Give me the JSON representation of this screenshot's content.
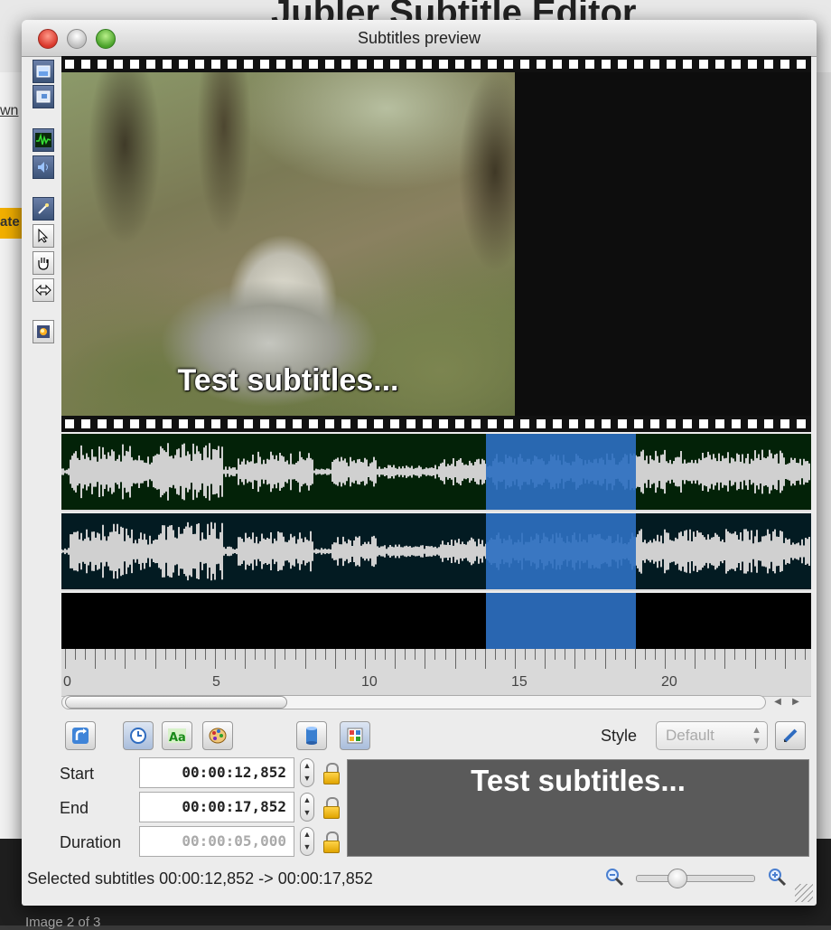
{
  "background": {
    "page_title": "Jubler Subtitle Editor",
    "fragment_1": "wn",
    "fragment_2": "ate",
    "caption": "Image 2 of 3"
  },
  "window": {
    "title": "Subtitles preview"
  },
  "video": {
    "subtitle_overlay": "Test subtitles..."
  },
  "ruler": {
    "labels": [
      "0",
      "5",
      "10",
      "15",
      "20"
    ]
  },
  "editor": {
    "style_label": "Style",
    "style_value": "Default",
    "start_label": "Start",
    "start_value": "00:00:12,852",
    "end_label": "End",
    "end_value": "00:00:17,852",
    "duration_label": "Duration",
    "duration_value": "00:00:05,000",
    "preview_text": "Test subtitles..."
  },
  "status": {
    "text": "Selected subtitles 00:00:12,852 -> 00:00:17,852"
  },
  "icons": {
    "tools": [
      "video-icon",
      "video-alt-icon",
      "waveform-icon",
      "audio-icon",
      "magic-wand-icon",
      "arrow-pointer-icon",
      "hand-icon",
      "resize-icon",
      "effects-icon"
    ],
    "buttons": [
      "undo-icon",
      "clock-icon",
      "text-icon",
      "palette-icon",
      "cylinder-icon",
      "grid-icon",
      "pencil-icon"
    ]
  },
  "colors": {
    "selection": "#2c6fc0",
    "wave_bg_1": "#032208",
    "wave_bg_2": "#031b22"
  }
}
